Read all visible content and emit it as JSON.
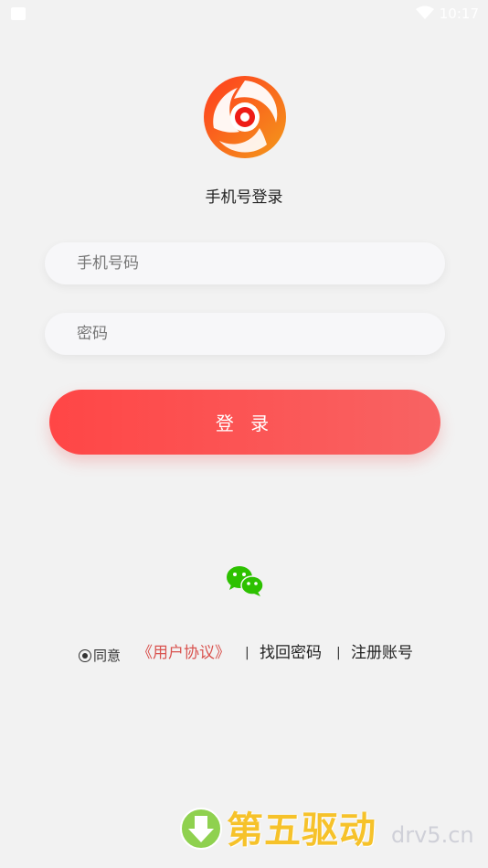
{
  "status_bar": {
    "time": "10:17"
  },
  "login": {
    "title": "手机号登录",
    "phone_placeholder": "手机号码",
    "password_placeholder": "密码",
    "login_button": "登 录"
  },
  "footer": {
    "agree_text": "同意",
    "agreement_link": "《用户协议》",
    "separator": "|",
    "forgot_password": "找回密码",
    "register": "注册账号"
  },
  "watermark": {
    "text": "第五驱动",
    "domain": "drv5.cn"
  },
  "colors": {
    "background": "#f2f2f2",
    "button_start": "#ff4646",
    "button_end": "#f86363",
    "agreement_link": "#d9534f",
    "wechat_green": "#2dc100"
  }
}
